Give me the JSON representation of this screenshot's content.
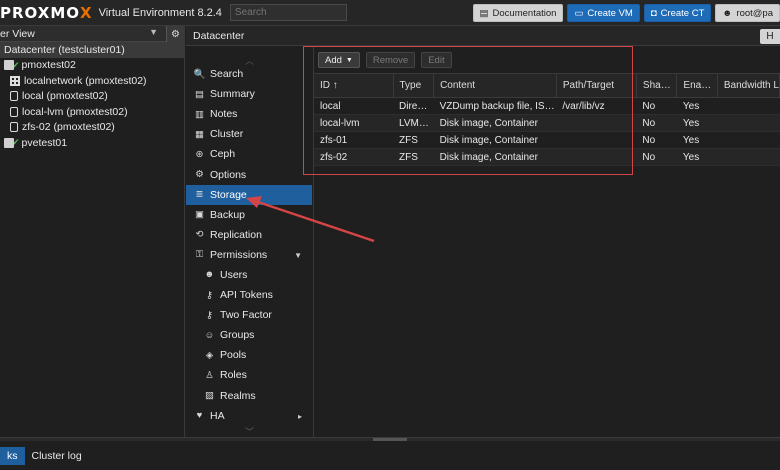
{
  "topbar": {
    "logo_pre": "PROXMO",
    "logo_x": "X",
    "version": "Virtual Environment 8.2.4",
    "search_placeholder": "Search",
    "buttons": {
      "documentation": "Documentation",
      "create_vm": "Create VM",
      "create_ct": "Create CT",
      "user": "root@pa"
    }
  },
  "sidebar": {
    "view_label": "er View",
    "tree": [
      {
        "label": "Datacenter (testcluster01)",
        "kind": "datacenter",
        "indent": 0
      },
      {
        "label": "pmoxtest02",
        "kind": "node",
        "indent": 0
      },
      {
        "label": "localnetwork (pmoxtest02)",
        "kind": "network",
        "indent": 1
      },
      {
        "label": "local (pmoxtest02)",
        "kind": "storage",
        "indent": 1
      },
      {
        "label": "local-lvm (pmoxtest02)",
        "kind": "storage",
        "indent": 1
      },
      {
        "label": "zfs-02 (pmoxtest02)",
        "kind": "storage",
        "indent": 1
      },
      {
        "label": "pvetest01",
        "kind": "node",
        "indent": 0
      }
    ]
  },
  "header": {
    "title": "Datacenter",
    "help_label": "H"
  },
  "nav": {
    "items": [
      {
        "label": "Search",
        "icon": "search-icon",
        "glyph": "🔍",
        "sub": false
      },
      {
        "label": "Summary",
        "icon": "book-icon",
        "glyph": "▤",
        "sub": false
      },
      {
        "label": "Notes",
        "icon": "notes-icon",
        "glyph": "▥",
        "sub": false
      },
      {
        "label": "Cluster",
        "icon": "server-icon",
        "glyph": "▦",
        "sub": false
      },
      {
        "label": "Ceph",
        "icon": "ceph-icon",
        "glyph": "⊛",
        "sub": false
      },
      {
        "label": "Options",
        "icon": "gear-icon",
        "glyph": "⚙",
        "sub": false
      },
      {
        "label": "Storage",
        "icon": "database-icon",
        "glyph": "≣",
        "sub": false,
        "active": true
      },
      {
        "label": "Backup",
        "icon": "floppy-icon",
        "glyph": "▣",
        "sub": false
      },
      {
        "label": "Replication",
        "icon": "retweet-icon",
        "glyph": "⟲",
        "sub": false
      },
      {
        "label": "Permissions",
        "icon": "unlock-icon",
        "glyph": "⚿",
        "sub": false,
        "caret": "▼"
      },
      {
        "label": "Users",
        "icon": "user-icon",
        "glyph": "☻",
        "sub": true
      },
      {
        "label": "API Tokens",
        "icon": "key-icon",
        "glyph": "⚷",
        "sub": true
      },
      {
        "label": "Two Factor",
        "icon": "key-icon",
        "glyph": "⚷",
        "sub": true
      },
      {
        "label": "Groups",
        "icon": "users-icon",
        "glyph": "☺",
        "sub": true
      },
      {
        "label": "Pools",
        "icon": "tags-icon",
        "glyph": "◈",
        "sub": true
      },
      {
        "label": "Roles",
        "icon": "male-icon",
        "glyph": "♙",
        "sub": true
      },
      {
        "label": "Realms",
        "icon": "address-book-icon",
        "glyph": "▧",
        "sub": true
      },
      {
        "label": "HA",
        "icon": "heartbeat-icon",
        "glyph": "♥",
        "sub": false,
        "caret": "▸"
      }
    ]
  },
  "toolbar": {
    "add_label": "Add",
    "remove_label": "Remove",
    "edit_label": "Edit"
  },
  "table": {
    "columns": [
      "ID ↑",
      "Type",
      "Content",
      "Path/Target",
      "Sha…",
      "Ena…",
      "Bandwidth L"
    ],
    "rows": [
      [
        "local",
        "Dire…",
        "VZDump backup file, IS…",
        "/var/lib/vz",
        "No",
        "Yes",
        ""
      ],
      [
        "local-lvm",
        "LVM…",
        "Disk image, Container",
        "",
        "No",
        "Yes",
        ""
      ],
      [
        "zfs-01",
        "ZFS",
        "Disk image, Container",
        "",
        "No",
        "Yes",
        ""
      ],
      [
        "zfs-02",
        "ZFS",
        "Disk image, Container",
        "",
        "No",
        "Yes",
        ""
      ]
    ]
  },
  "bottom": {
    "tabs": [
      "ks",
      "Cluster log"
    ]
  },
  "colors": {
    "accent": "#1f5f9e",
    "brand_orange": "#e57000",
    "annotation_red": "#d64545",
    "status_green": "#5cb85c"
  }
}
